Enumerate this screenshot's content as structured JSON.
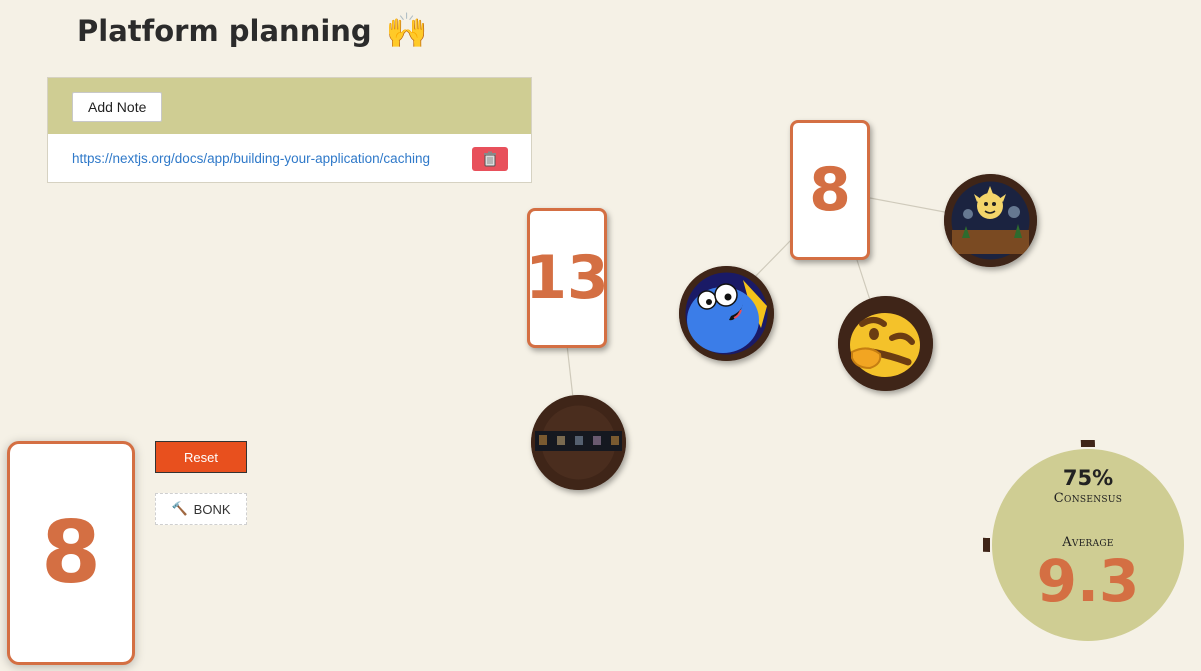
{
  "header": {
    "title": "Platform planning",
    "emoji": "🙌"
  },
  "notes": {
    "add_label": "Add Note",
    "items": [
      {
        "url": "https://nextjs.org/docs/app/building-your-application/caching"
      }
    ]
  },
  "votes": [
    {
      "value": "13"
    },
    {
      "value": "8"
    }
  ],
  "controls": {
    "reset_label": "Reset",
    "bonk_label": "BONK",
    "bonk_emoji": "🔨"
  },
  "my_card": {
    "value": "8"
  },
  "stats": {
    "consensus_pct": "75%",
    "consensus_label": "Consensus",
    "average_label": "Average",
    "average_value": "9.3",
    "consensus_fraction": 0.75
  },
  "colors": {
    "accent": "#d46f43",
    "panel": "#cfcd93",
    "ring": "#3f2518",
    "danger": "#e8505b",
    "reset": "#e8501e",
    "background": "#f5f1e6"
  }
}
